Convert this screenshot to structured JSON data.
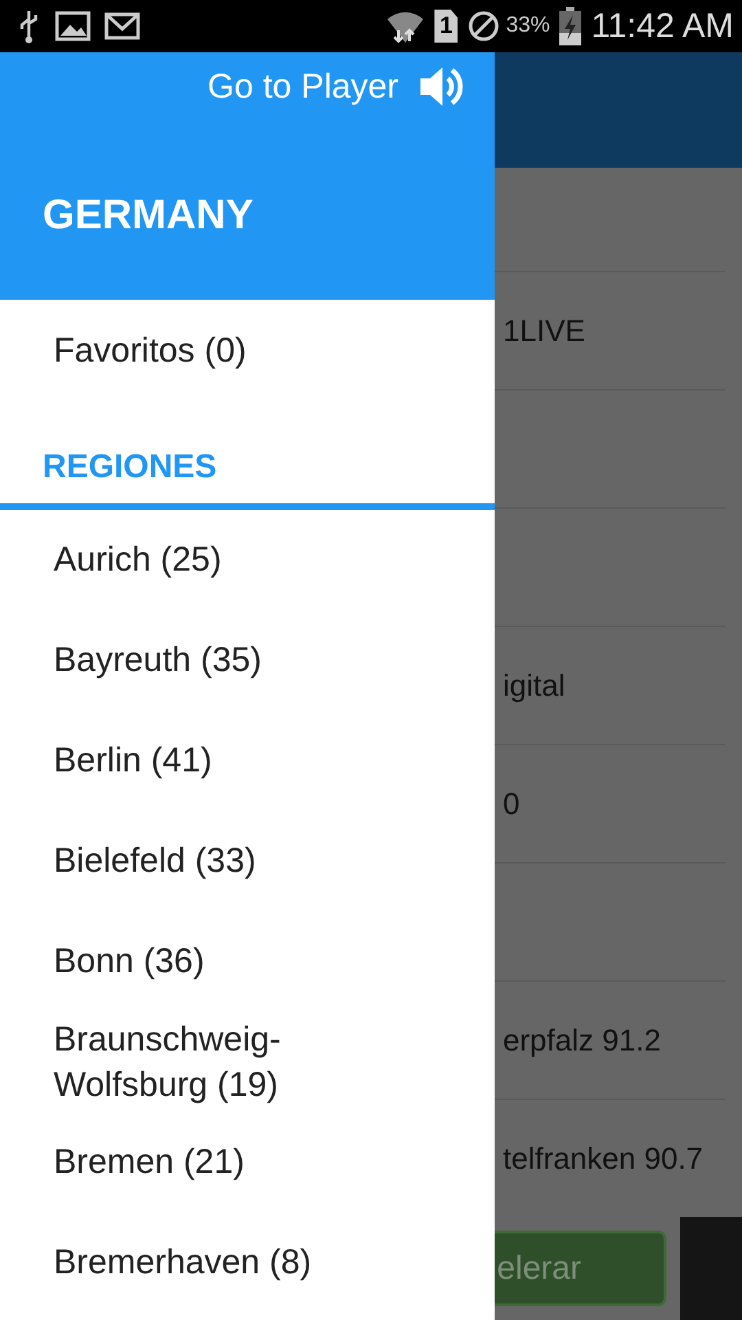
{
  "status_bar": {
    "sim_slot": "1",
    "battery": "33%",
    "time": "11:42 AM"
  },
  "background": {
    "rows": [
      {
        "title": "1LIVE"
      },
      {},
      {},
      {
        "title": "igital"
      },
      {
        "title": "0"
      },
      {},
      {
        "title": "erpfalz 91.2"
      },
      {
        "title": "telfranken 90.7"
      }
    ],
    "button": "elerar"
  },
  "drawer": {
    "player_link": "Go to Player",
    "country": "GERMANY",
    "favorites": "Favoritos (0)",
    "section": "REGIONES",
    "regions": [
      {
        "label": "Aurich (25)"
      },
      {
        "label": "Bayreuth (35)"
      },
      {
        "label": "Berlin (41)"
      },
      {
        "label": "Bielefeld (33)"
      },
      {
        "label": "Bonn (36)"
      },
      {
        "label": "Braunschweig-\nWolfsburg (19)"
      },
      {
        "label": "Bremen (21)"
      },
      {
        "label": "Bremerhaven (8)"
      }
    ]
  }
}
